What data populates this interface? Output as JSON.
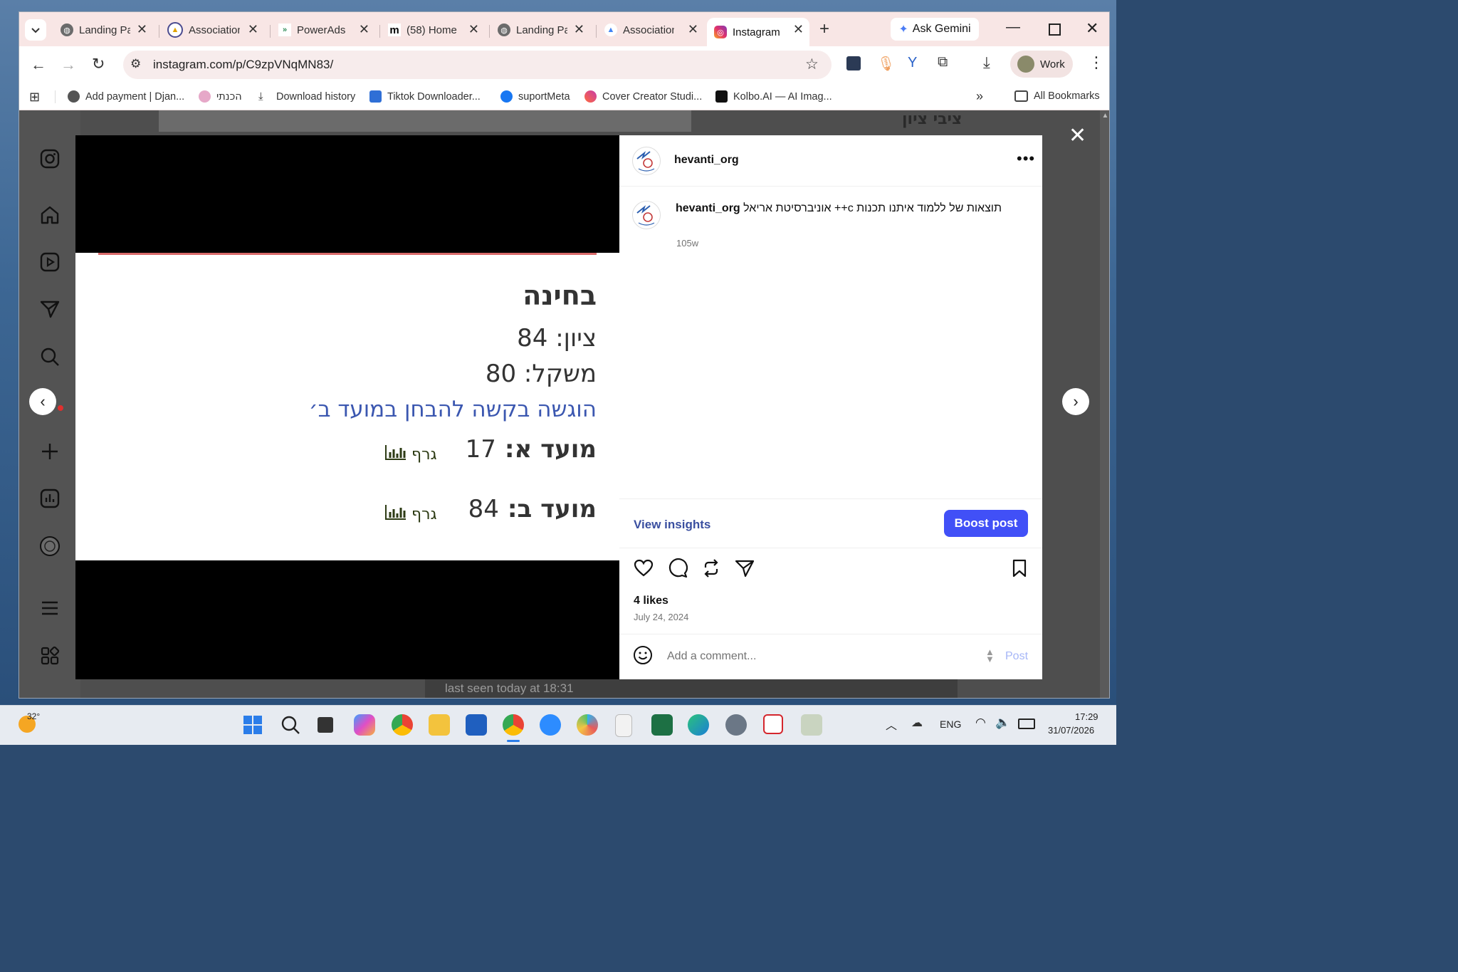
{
  "browser": {
    "tabs": [
      {
        "label": "Landing Pa",
        "icon": "globe-icon"
      },
      {
        "label": "Association",
        "icon": "google-ads-icon"
      },
      {
        "label": "PowerAds",
        "icon": "powerads-icon"
      },
      {
        "label": "(58) Home",
        "icon": "medium-icon"
      },
      {
        "label": "Landing Pa",
        "icon": "globe-icon"
      },
      {
        "label": "Association",
        "icon": "google-ads-icon"
      },
      {
        "label": "Instagram",
        "icon": "instagram-icon",
        "active": true
      }
    ],
    "new_tab": "+",
    "ask_gemini": "Ask Gemini",
    "url": "instagram.com/p/C9zpVNqMN83/",
    "profile": "Work",
    "bookmarks": [
      {
        "label": "Add payment | Djan...",
        "icon": "globe-icon"
      },
      {
        "label": "הכנתי",
        "icon": "balloon-icon"
      },
      {
        "label": "Download history",
        "icon": "download-icon"
      },
      {
        "label": "Tiktok Downloader...",
        "icon": "download-box-icon"
      },
      {
        "label": "suportMeta",
        "icon": "facebook-icon"
      },
      {
        "label": "Cover Creator Studi...",
        "icon": "cover-creator-icon"
      },
      {
        "label": "Kolbo.AI — AI Imag...",
        "icon": "kolbo-icon"
      }
    ],
    "all_bookmarks": "All Bookmarks",
    "overflow": "»"
  },
  "post": {
    "username": "hevanti_org",
    "caption_user": "hevanti_org",
    "caption_text": "תוצאות של ללמוד איתנו תכנות c++ אוניברסיטת אריאל",
    "caption_age": "105w",
    "view_insights": "View insights",
    "boost_post": "Boost post",
    "likes": "4 likes",
    "date": "July 24, 2024",
    "comment_placeholder": "Add a comment...",
    "post_button": "Post"
  },
  "slide": {
    "heading": "בחינה",
    "grade_line": "ציון: 84",
    "weight_line": "משקל: 80",
    "request_line": "הוגשה בקשה להבחן במועד ב׳",
    "moed_a_label": "מועד א:",
    "moed_a_value": "17",
    "moed_b_label": "מועד ב:",
    "moed_b_value": "84",
    "graph_label": "גרף"
  },
  "background_fragments": {
    "top_right_hebrew": "ציבי ציון",
    "last_seen": "last seen today at 18:31"
  },
  "taskbar": {
    "weather_temp": "32°",
    "lang": "ENG",
    "time": "17:29",
    "date": "31/07/2026"
  },
  "colors": {
    "accent_blue": "#4150f7",
    "link_blue": "#3a4fa0",
    "tabbar_bg": "#f8e6e5",
    "slide_link": "#3b57b0",
    "graph_green": "#2d3b14"
  }
}
